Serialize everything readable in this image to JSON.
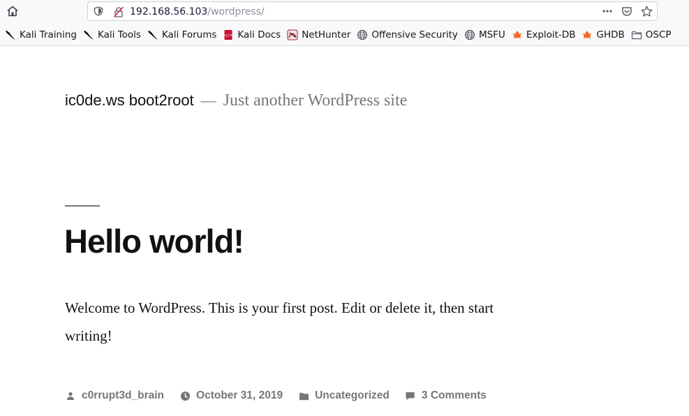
{
  "browser": {
    "url_host": "192.168.56.103",
    "url_path": "/wordpress/",
    "bookmarks": [
      {
        "label": "Kali Training",
        "icon": "kali-dragon-icon"
      },
      {
        "label": "Kali Tools",
        "icon": "kali-dragon-icon"
      },
      {
        "label": "Kali Forums",
        "icon": "kali-dragon-icon"
      },
      {
        "label": "Kali Docs",
        "icon": "kali-docs-icon"
      },
      {
        "label": "NetHunter",
        "icon": "nethunter-icon"
      },
      {
        "label": "Offensive Security",
        "icon": "globe-icon"
      },
      {
        "label": "MSFU",
        "icon": "globe-icon"
      },
      {
        "label": "Exploit-DB",
        "icon": "exploitdb-icon"
      },
      {
        "label": "GHDB",
        "icon": "exploitdb-icon"
      },
      {
        "label": "OSCP",
        "icon": "folder-icon"
      }
    ]
  },
  "site": {
    "title": "ic0de.ws boot2root",
    "separator": "—",
    "description": "Just another WordPress site"
  },
  "post": {
    "title": "Hello world!",
    "content": "Welcome to WordPress. This is your first post. Edit or delete it, then start writing!",
    "author": "c0rrupt3d_brain",
    "date": "October 31, 2019",
    "category": "Uncategorized",
    "comments": "3 Comments"
  },
  "colors": {
    "meta_gray": "#767676",
    "text": "#111111",
    "exploitdb_orange": "#f26b22",
    "kali_docs_red": "#c8102e"
  }
}
